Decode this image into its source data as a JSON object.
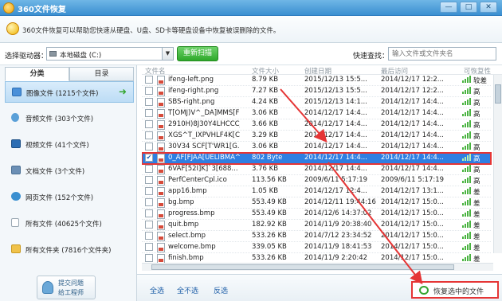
{
  "window": {
    "title": "360文件恢复",
    "min_label": "—",
    "max_label": "□",
    "close_label": "✕"
  },
  "info": {
    "text": "360文件恢复可以帮助您快速从硬盘、U盘、SD卡等硬盘设备中恢复被误删除的文件。"
  },
  "toolbar": {
    "drive_label": "选择驱动器：",
    "drive_value": "本地磁盘 (C:)",
    "rescan_label": "重新扫描",
    "search_label": "快速查找：",
    "search_placeholder": "输入文件或文件夹名"
  },
  "sidebar": {
    "tabs": [
      {
        "label": "分类"
      },
      {
        "label": "目录"
      }
    ],
    "items": [
      {
        "label": "图像文件 (1215个文件)",
        "icon": "image-icon",
        "color": "#4a90d9"
      },
      {
        "label": "音频文件 (303个文件)",
        "icon": "music-icon",
        "color": "#5aa0d8"
      },
      {
        "label": "视频文件 (41个文件)",
        "icon": "video-icon",
        "color": "#2c6db3"
      },
      {
        "label": "文档文件 (3个文件)",
        "icon": "document-icon",
        "color": "#6b8fb5"
      },
      {
        "label": "网页文件 (152个文件)",
        "icon": "globe-icon",
        "color": "#3a8fd0"
      },
      {
        "label": "所有文件 (40625个文件)",
        "icon": "file-icon",
        "color": "#d5dde3"
      },
      {
        "label": "所有文件夹 (7816个文件夹)",
        "icon": "folder-icon",
        "color": "#f0c24a"
      }
    ],
    "active_arrow": "➜",
    "feedback_line1": "提交问题",
    "feedback_line2": "给工程师"
  },
  "filelist": {
    "headers": {
      "name": "文件名",
      "size": "文件大小",
      "created": "创建日期",
      "accessed": "最后访问",
      "quality": "可恢复性"
    },
    "rows": [
      {
        "name": "ifeng-left.png",
        "size": "8.79 KB",
        "created": "2015/12/13 15:5...",
        "accessed": "2014/12/17 12:2...",
        "quality": "较差",
        "checked": false
      },
      {
        "name": "ifeng-right.png",
        "size": "7.27 KB",
        "created": "2015/12/13 15:5...",
        "accessed": "2014/12/17 12:2...",
        "quality": "高",
        "checked": false
      },
      {
        "name": "SBS-right.png",
        "size": "4.24 KB",
        "created": "2015/12/13 14:1...",
        "accessed": "2014/12/17 14:4...",
        "quality": "高",
        "checked": false
      },
      {
        "name": "T[OMJ)V^_DA]MMS[F2...",
        "size": "3.06 KB",
        "created": "2014/12/17 14:4...",
        "accessed": "2014/12/17 14:4...",
        "quality": "高",
        "checked": false
      },
      {
        "name": "2910H)8J30Y4LHCCC_...",
        "size": "3.66 KB",
        "created": "2014/12/17 14:4...",
        "accessed": "2014/12/17 14:4...",
        "quality": "高",
        "checked": false
      },
      {
        "name": "XGS^T_IXPVHLF4K[CX...",
        "size": "3.29 KB",
        "created": "2014/12/17 14:4...",
        "accessed": "2014/12/17 14:4...",
        "quality": "高",
        "checked": false
      },
      {
        "name": "30V34 SCF[T'WR1[G...",
        "size": "3.06 KB",
        "created": "2014/12/17 14:4...",
        "accessed": "2014/12/17 14:4...",
        "quality": "高",
        "checked": false
      },
      {
        "name": "0_AF[FJAA[UELIBMA^...",
        "size": "802 Byte",
        "created": "2014/12/17 14:4...",
        "accessed": "2014/12/17 14:4...",
        "quality": "高",
        "checked": true
      },
      {
        "name": "6VAF[52I]K]`3[688...",
        "size": "3.76 KB",
        "created": "2014/12/17 14:4...",
        "accessed": "2014/12/17 14:4...",
        "quality": "高",
        "checked": false
      },
      {
        "name": "PerfCenterCpl.ico",
        "size": "113.56 KB",
        "created": "2009/6/11 5:17:19",
        "accessed": "2009/6/11 5:17:19",
        "quality": "高",
        "checked": false
      },
      {
        "name": "app16.bmp",
        "size": "1.05 KB",
        "created": "2014/12/17 12:4...",
        "accessed": "2014/12/17 13:1...",
        "quality": "差",
        "checked": false
      },
      {
        "name": "bg.bmp",
        "size": "553.49 KB",
        "created": "2014/12/11 19:44:16",
        "accessed": "2014/12/17 15:0...",
        "quality": "差",
        "checked": false
      },
      {
        "name": "progress.bmp",
        "size": "553.49 KB",
        "created": "2014/12/6 14:37:02",
        "accessed": "2014/12/17 15:0...",
        "quality": "差",
        "checked": false
      },
      {
        "name": "quit.bmp",
        "size": "182.92 KB",
        "created": "2014/11/9 20:38:40",
        "accessed": "2014/12/17 15:0...",
        "quality": "差",
        "checked": false
      },
      {
        "name": "select.bmp",
        "size": "533.26 KB",
        "created": "2014/7/12 23:34:52",
        "accessed": "2014/12/17 15:0...",
        "quality": "差",
        "checked": false
      },
      {
        "name": "welcome.bmp",
        "size": "339.05 KB",
        "created": "2014/11/9 18:41:53",
        "accessed": "2014/12/17 15:0...",
        "quality": "差",
        "checked": false
      },
      {
        "name": "finish.bmp",
        "size": "533.26 KB",
        "created": "2014/11/9 2:20:42",
        "accessed": "2014/12/17 15:0...",
        "quality": "差",
        "checked": false
      }
    ]
  },
  "bottom": {
    "select_all": "全选",
    "select_none": "全不选",
    "invert": "反选",
    "restore": "恢复选中的文件"
  },
  "colors": {
    "accent": "#3a8fd0",
    "selected_row": "#2f7fe2",
    "highlight": "#e53535",
    "quality_bar": "#49b340"
  }
}
